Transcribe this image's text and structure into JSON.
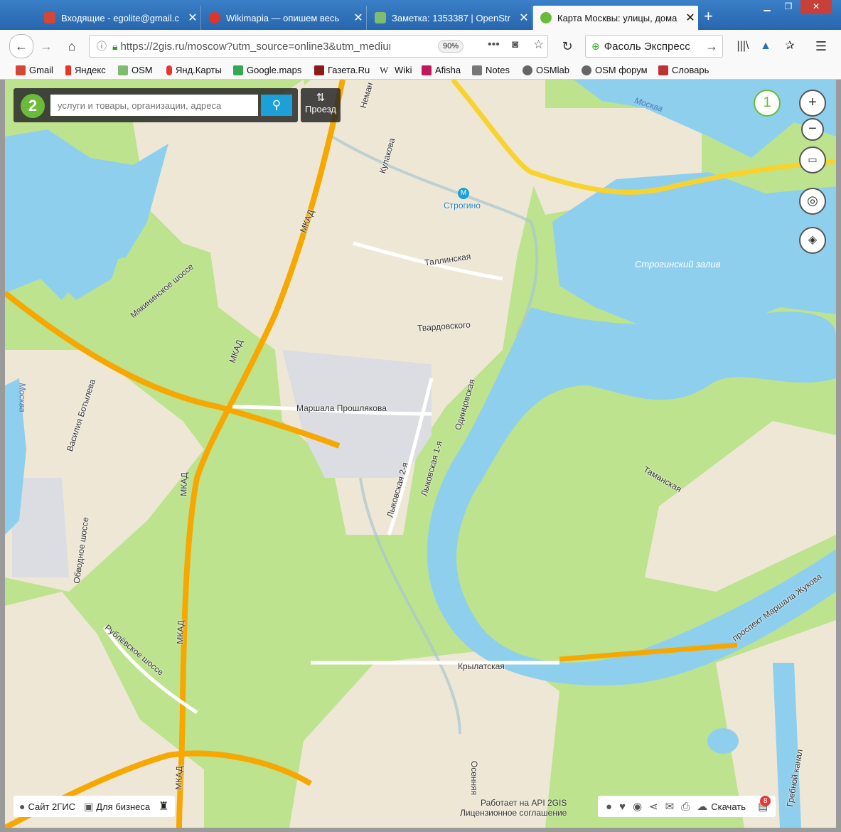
{
  "browser": {
    "tabs": [
      {
        "title": "Входящие - egolite@gmail.c",
        "color": "#d44638"
      },
      {
        "title": "Wikimapia — опишем весь",
        "color": "#e0342b"
      },
      {
        "title": "Заметка: 1353387 | OpenStr",
        "color": "#7ebc6f"
      },
      {
        "title": "Карта Москвы: улицы, дома",
        "color": "#6bbb3a"
      }
    ],
    "new_tab": "+",
    "url": "https://2gis.ru/moscow?utm_source=online3&utm_medium",
    "zoom": "90%",
    "search_value": "Фасоль Экспресс",
    "bookmarks": [
      {
        "label": "Gmail",
        "color": "#d44638"
      },
      {
        "label": "Яндекс",
        "color": "#e32"
      },
      {
        "label": "OSM",
        "color": "#7ebc6f"
      },
      {
        "label": "Янд.Карты",
        "color": "#e33"
      },
      {
        "label": "Google.maps",
        "color": "#34a853"
      },
      {
        "label": "Газета.Ru",
        "color": "#8b1a1a"
      },
      {
        "label": "Wiki",
        "color": "#333"
      },
      {
        "label": "Afisha",
        "color": "#c2185b"
      },
      {
        "label": "Notes",
        "color": "#555"
      },
      {
        "label": "OSMlab",
        "color": "#555"
      },
      {
        "label": "OSM форум",
        "color": "#555"
      },
      {
        "label": "Словарь",
        "color": "#b33"
      }
    ]
  },
  "map": {
    "logo": "2",
    "search_placeholder": "услуги и товары, организации, адреса",
    "route_label": "Проезд",
    "floor_button": "1",
    "zoom_in": "+",
    "zoom_out": "−",
    "labels": {
      "moskva_top": "Москва",
      "moskva_left": "Москва",
      "strogino_metro": "Строгино",
      "strogino_bay": "Строгинский залив",
      "tallinskaya": "Таллинская",
      "tvardovskogo": "Твардовского",
      "marshala": "Маршала Прошлякова",
      "mkad1": "МКАД",
      "mkad2": "МКАД",
      "mkad3": "МКАД",
      "mkad4": "МКАД",
      "mkad5": "МКАД",
      "myakininskoe": "Мякининское шоссе",
      "vasiliya": "Василия Ботылева",
      "obvodnoe": "Обводное шоссе",
      "rublevskoe": "Рублёвское шоссе",
      "lykovskaya2": "Лыковская 2-я",
      "lykovskaya1": "Лыковская 1-я",
      "odincovskaya": "Одинцовская",
      "kulakova": "Кулакова",
      "neman": "Неман",
      "tamanskaya": "Таманская",
      "krylatskaya": "Крылатская",
      "osennyaya": "Осенняя",
      "zhukova": "проспект Маршала Жукова",
      "grebnoy": "Гребной канал"
    },
    "bottom_left": {
      "site": "Сайт 2ГИС",
      "business": "Для бизнеса"
    },
    "credit": {
      "line1": "Работает на API 2GIS",
      "line2": "Лицензионное соглашение"
    },
    "download": "Скачать",
    "badge_count": "8"
  }
}
